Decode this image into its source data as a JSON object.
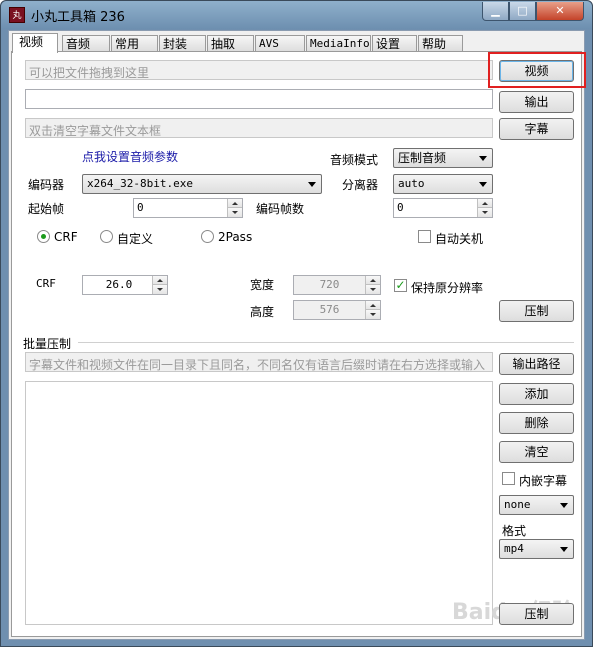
{
  "window": {
    "title": "小丸工具箱 236",
    "icon_text": "丸"
  },
  "titlebar_buttons": {
    "minimize": "▁",
    "maximize": "□",
    "close": "✕"
  },
  "tabs": [
    {
      "label": "视频"
    },
    {
      "label": "音频"
    },
    {
      "label": "常用"
    },
    {
      "label": "封装"
    },
    {
      "label": "抽取"
    },
    {
      "label": "AVS"
    },
    {
      "label": "MediaInfo"
    },
    {
      "label": "设置"
    },
    {
      "label": "帮助"
    }
  ],
  "video": {
    "drop_placeholder": "可以把文件拖拽到这里",
    "video_button": "视频",
    "output_button": "输出",
    "subtitle_placeholder": "双击清空字幕文件文本框",
    "subtitle_button": "字幕",
    "audio_link": "点我设置音频参数",
    "audio_mode_label": "音频模式",
    "audio_mode_value": "压制音频",
    "encoder_label": "编码器",
    "encoder_value": "x264_32-8bit.exe",
    "demuxer_label": "分离器",
    "demuxer_value": "auto",
    "start_frame_label": "起始帧",
    "start_frame_value": "0",
    "encode_frames_label": "编码帧数",
    "encode_frames_value": "0",
    "mode_crf": "CRF",
    "mode_custom": "自定义",
    "mode_2pass": "2Pass",
    "auto_shutdown": "自动关机",
    "crf_label": "CRF",
    "crf_value": "26.0",
    "width_label": "宽度",
    "width_value": "720",
    "height_label": "高度",
    "height_value": "576",
    "keep_resolution": "保持原分辨率",
    "encode_button": "压制"
  },
  "batch": {
    "title": "批量压制",
    "hint": "字幕文件和视频文件在同一目录下且同名，不同名仅有语言后缀时请在右方选择或输入",
    "output_path_button": "输出路径",
    "add_button": "添加",
    "delete_button": "删除",
    "clear_button": "清空",
    "embed_subtitle": "内嵌字幕",
    "subtitle_combo": "none",
    "format_label": "格式",
    "format_combo": "mp4",
    "encode_button": "压制"
  },
  "watermark": "Baidu 经验"
}
